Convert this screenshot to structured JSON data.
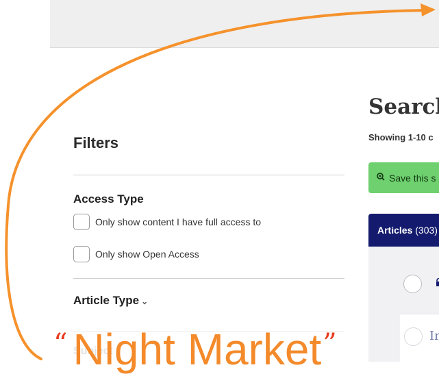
{
  "filters": {
    "title": "Filters",
    "access_type": {
      "title": "Access Type",
      "options": [
        "Only show content I have full access to",
        "Only show Open Access"
      ]
    },
    "article_type": {
      "title": "Article Type"
    },
    "subject": {
      "title": "Subject"
    }
  },
  "results": {
    "heading": "Search",
    "showing": "Showing 1-10 c",
    "save_button": "Save this s",
    "tab": {
      "label": "Articles",
      "count": "(303)"
    },
    "first_result_title": "In"
  },
  "overlay": {
    "caption": "Night Market",
    "quote_open": "“",
    "quote_close": "”"
  },
  "colors": {
    "arrow": "#f5922c",
    "tab_active": "#141b6e",
    "save_button": "#6ed06e"
  }
}
